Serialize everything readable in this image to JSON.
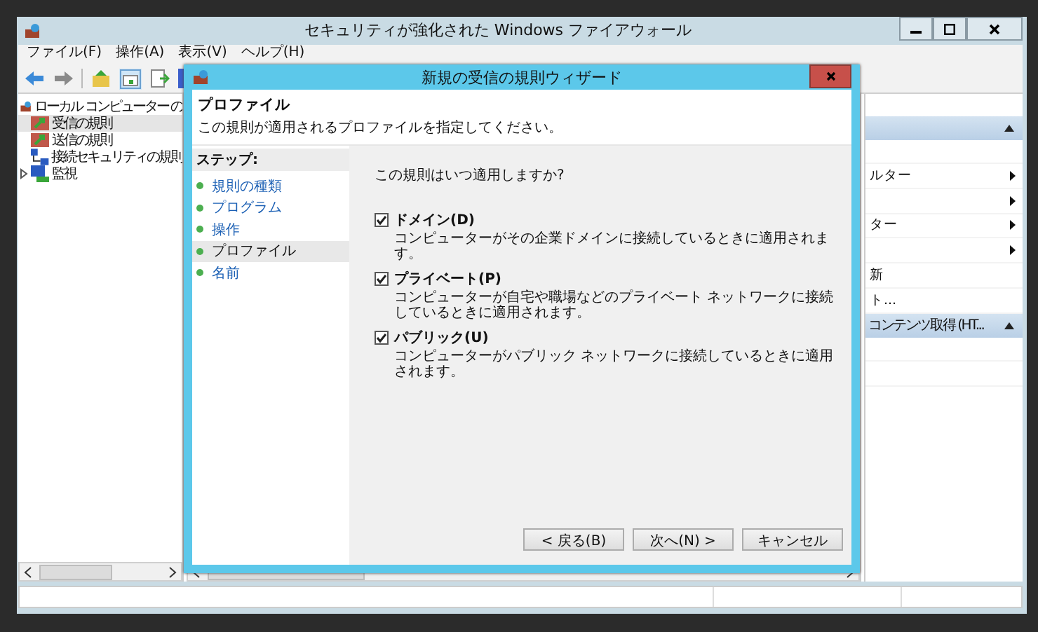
{
  "window": {
    "title": "セキュリティが強化された Windows ファイアウォール",
    "menu": [
      "ファイル(F)",
      "操作(A)",
      "表示(V)",
      "ヘルプ(H)"
    ]
  },
  "tree": [
    {
      "label": "ローカル コンピューター の",
      "selected": false,
      "children": [
        {
          "label": "受信の規則",
          "selected": true
        },
        {
          "label": "送信の規則",
          "selected": false
        },
        {
          "label": "接続セキュリティの規則",
          "selected": false
        },
        {
          "label": "監視",
          "selected": false,
          "expanded": false
        }
      ]
    }
  ],
  "actions": [
    {
      "expanded": true,
      "items": [
        {
          "label": "ルター",
          "submenu": true
        },
        {
          "submenu": true
        },
        {
          "label": "ター",
          "submenu": true
        },
        {
          "submenu": true
        },
        {
          "label": "新",
          "submenu": false
        },
        {
          "label": "ト...",
          "submenu": false
        }
      ]
    },
    {
      "title": "コンテンツ取得 (HT...",
      "expanded": true
    }
  ],
  "dialog": {
    "title": "新規の受信の規則ウィザード",
    "header": {
      "title": "プロファイル",
      "subtitle": "この規則が適用されるプロファイルを指定してください。"
    },
    "steps_title": "ステップ:",
    "steps": [
      {
        "label": "規則の種類",
        "selected": false
      },
      {
        "label": "プログラム",
        "selected": false
      },
      {
        "label": "操作",
        "selected": false
      },
      {
        "label": "プロファイル",
        "selected": true
      },
      {
        "label": "名前",
        "selected": false
      }
    ],
    "question": "この規則はいつ適用しますか?",
    "options": [
      {
        "label": "ドメイン(D)",
        "description": "コンピューターがその企業ドメインに接続しているときに適用されます。",
        "checked": true
      },
      {
        "label": "プライベート(P)",
        "description": "コンピューターが自宅や職場などのプライベート ネットワークに接続しているときに適用されます。",
        "checked": true
      },
      {
        "label": "パブリック(U)",
        "description": "コンピューターがパブリック ネットワークに接続しているときに適用されます。",
        "checked": true
      }
    ],
    "buttons": [
      "< 戻る(B)",
      "次へ(N) >",
      "キャンセル"
    ]
  }
}
